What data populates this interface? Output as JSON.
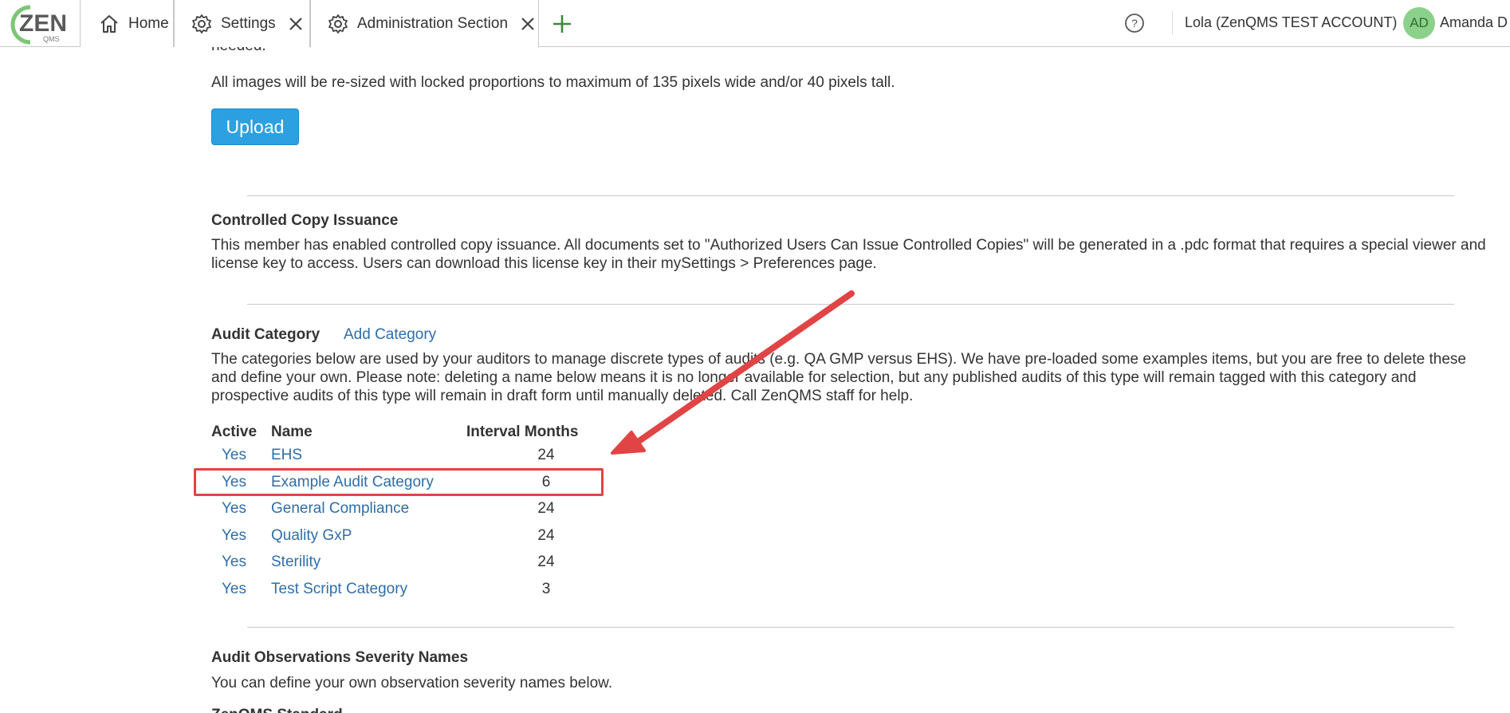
{
  "header": {
    "logo_text": "ZEN",
    "logo_sub": "QMS",
    "tabs": [
      {
        "label": "Home"
      },
      {
        "label": "Settings"
      },
      {
        "label": "Administration Section"
      }
    ],
    "account": "Lola (ZenQMS TEST ACCOUNT)",
    "avatar_initials": "AD",
    "user": "Amanda D"
  },
  "images": {
    "cut_text": "needed.",
    "resize_note": "All images will be re-sized with locked proportions to maximum of 135 pixels wide and/or 40 pixels tall.",
    "upload_label": "Upload"
  },
  "controlled_copy": {
    "title": "Controlled Copy Issuance",
    "body": "This member has enabled controlled copy issuance. All documents set to \"Authorized Users Can Issue Controlled Copies\" will be generated in a .pdc format that requires a special viewer and license key to access. Users can download this license key in their mySettings > Preferences page."
  },
  "audit_category": {
    "title": "Audit Category",
    "add_label": "Add Category",
    "body": "The categories below are used by your auditors to manage discrete types of audits (e.g. QA GMP versus EHS). We have pre-loaded some examples items, but you are free to delete these and define your own. Please note: deleting a name below means it is no longer available for selection, but any published audits of this type will remain tagged with this category and prospective audits of this type will remain in draft form until manually deleted. Call ZenQMS staff for help.",
    "columns": [
      "Active",
      "Name",
      "Interval Months"
    ],
    "rows": [
      {
        "active": "Yes",
        "name": "EHS",
        "months": "24"
      },
      {
        "active": "Yes",
        "name": "Example Audit Category",
        "months": "6"
      },
      {
        "active": "Yes",
        "name": "General Compliance",
        "months": "24"
      },
      {
        "active": "Yes",
        "name": "Quality GxP",
        "months": "24"
      },
      {
        "active": "Yes",
        "name": "Sterility",
        "months": "24"
      },
      {
        "active": "Yes",
        "name": "Test Script Category",
        "months": "3"
      }
    ]
  },
  "severity": {
    "title": "Audit Observations Severity Names",
    "body": "You can define your own observation severity names below.",
    "next_cut": "ZenQMS Standard"
  },
  "colors": {
    "link": "#2f6ea8",
    "upload": "#2ca0e0",
    "annotation": "#e04444",
    "avatar": "#8bd08b"
  }
}
